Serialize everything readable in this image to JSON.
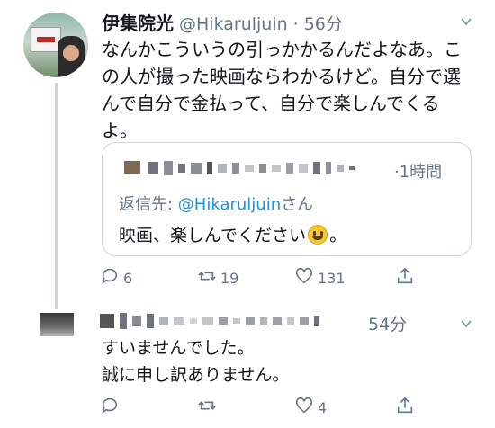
{
  "tweet": {
    "display_name": "伊集院光",
    "handle": "@Hikaruljuin",
    "separator": "·",
    "time": "56分",
    "text_lines": [
      "なんかこういうの引っかかるんだよなあ。こ",
      "の人が撮った映画ならわかるけど。自分で選",
      "んで自分で金払って、自分で楽しんでくる",
      "よ。"
    ],
    "quote": {
      "time": "·1時間",
      "reply_prefix": "返信先: ",
      "reply_mention": "@Hikaruljuin",
      "reply_suffix": "さん",
      "text_before": "映画、楽しんでください",
      "emoji": "grinning-face",
      "text_after": "。"
    },
    "actions": {
      "reply": "6",
      "retweet": "19",
      "like": "131"
    }
  },
  "reply": {
    "time": "54分",
    "text_lines": [
      "すいませんでした。",
      "誠に申し訳ありません。"
    ],
    "actions": {
      "reply": "",
      "retweet": "",
      "like": "4"
    }
  },
  "colors": {
    "secondary_text": "#657786",
    "link": "#1b95e0",
    "border": "#ccd6dd"
  }
}
